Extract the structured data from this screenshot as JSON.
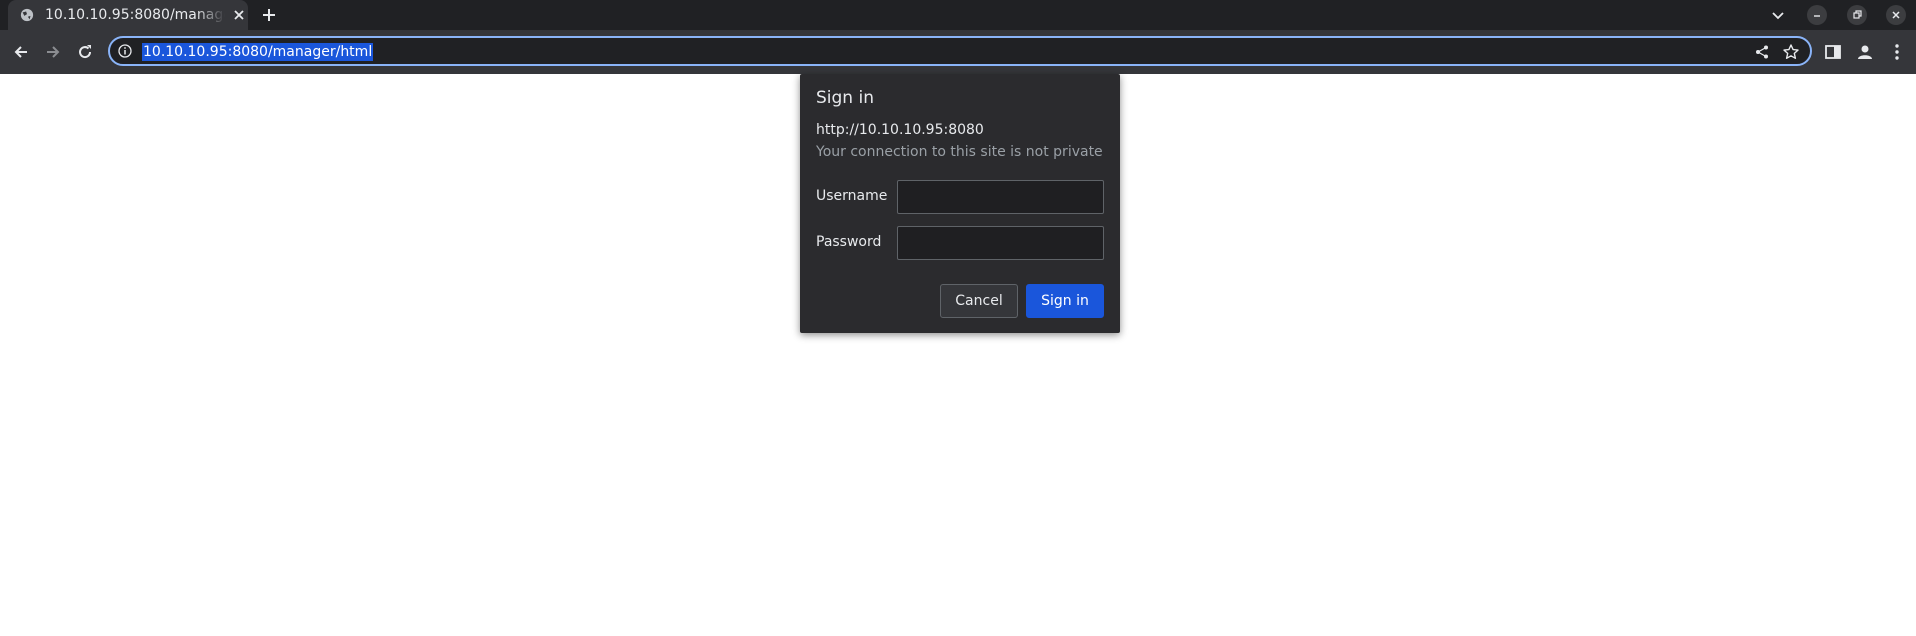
{
  "browser": {
    "tab": {
      "title": "10.10.10.95:8080/manager/html",
      "favicon": "globe-icon",
      "close_icon": "close-icon"
    },
    "new_tab_icon": "plus-icon",
    "window_controls": [
      "chevron-down-icon",
      "minimize-icon",
      "restore-icon",
      "close-icon"
    ],
    "toolbar": {
      "back_icon": "arrow-left-icon",
      "forward_icon": "arrow-right-icon",
      "reload_icon": "reload-icon",
      "side_panel_icon": "side-panel-icon",
      "profile_icon": "profile-icon",
      "menu_icon": "kebab-menu-icon"
    },
    "omnibox": {
      "url": "10.10.10.95:8080/manager/html",
      "security_icon": "info-icon",
      "share_icon": "share-icon",
      "bookmark_icon": "star-icon"
    }
  },
  "dialog": {
    "title": "Sign in",
    "origin": "http://10.10.10.95:8080",
    "warning": "Your connection to this site is not private",
    "username_label": "Username",
    "username_value": "",
    "password_label": "Password",
    "password_value": "",
    "cancel_label": "Cancel",
    "signin_label": "Sign in"
  },
  "colors": {
    "tabstrip_bg": "#202124",
    "toolbar_bg": "#35363a",
    "dialog_bg": "#2b2b2e",
    "accent": "#1a56db",
    "focus_ring": "#8ab4f8"
  }
}
